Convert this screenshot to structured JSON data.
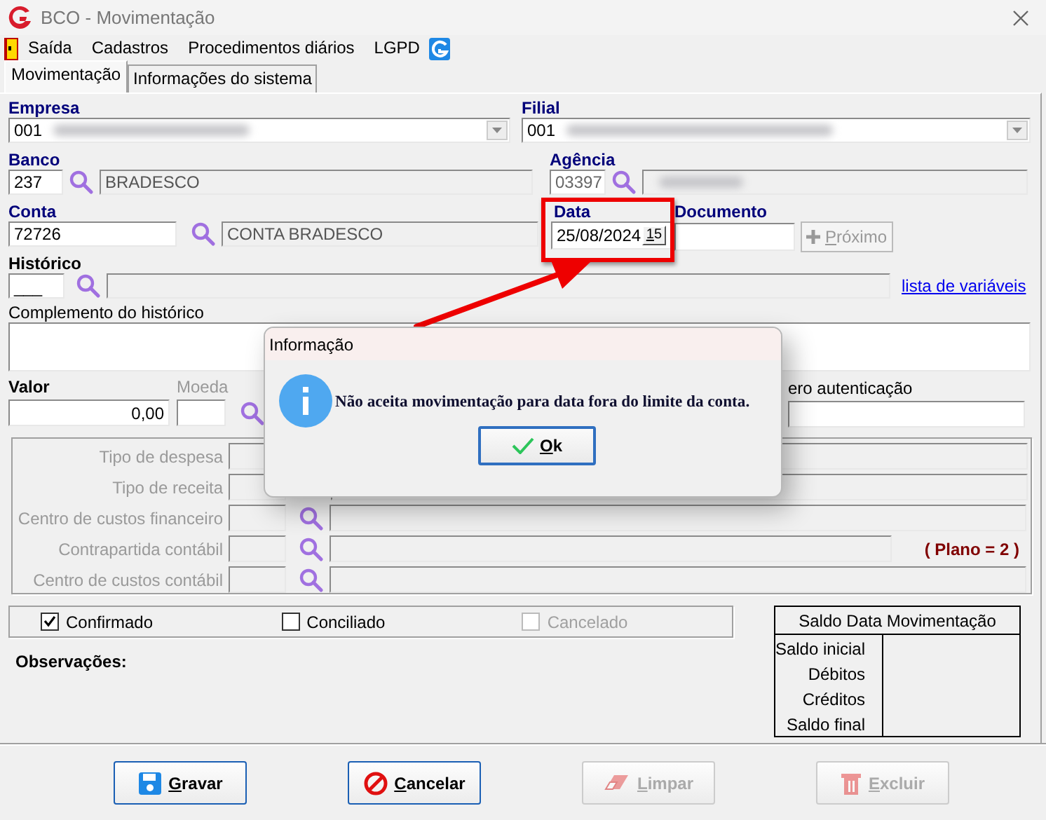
{
  "window": {
    "title": "BCO - Movimentação"
  },
  "menu": [
    {
      "label": "Saída"
    },
    {
      "label": "Cadastros"
    },
    {
      "label": "Procedimentos diários"
    },
    {
      "label": "LGPD"
    }
  ],
  "tabs": [
    {
      "label": "Movimentação",
      "selected": true
    },
    {
      "label": "Informações do sistema",
      "selected": false
    }
  ],
  "empresa": {
    "label": "Empresa",
    "value": "001"
  },
  "filial": {
    "label": "Filial",
    "value": "001"
  },
  "banco": {
    "label": "Banco",
    "code": "237",
    "name": "BRADESCO"
  },
  "agencia": {
    "label": "Agência",
    "code": "03397"
  },
  "conta": {
    "label": "Conta",
    "code": "72726",
    "name": "CONTA BRADESCO"
  },
  "data": {
    "label": "Data",
    "value": "25/08/2024",
    "calendar_button": "15"
  },
  "documento": {
    "label": "Documento"
  },
  "next_button": {
    "label": "Próximo",
    "disabled": true
  },
  "historico": {
    "label": "Histórico",
    "code": "___"
  },
  "variables_link": "lista de variáveis",
  "complemento": {
    "label": "Complemento do histórico"
  },
  "valor": {
    "label": "Valor",
    "value": "0,00"
  },
  "moeda": {
    "label": "Moeda"
  },
  "autenticacao": {
    "label": "ero autenticação"
  },
  "classification_rows": [
    {
      "label": "Tipo de despesa",
      "search": false
    },
    {
      "label": "Tipo de receita",
      "search": false
    },
    {
      "label": "Centro de custos financeiro",
      "search": true
    },
    {
      "label": "Contrapartida contábil",
      "search": true,
      "note": "( Plano = 2 )"
    },
    {
      "label": "Centro de custos contábil",
      "search": true
    }
  ],
  "flags": [
    {
      "label": "Confirmado",
      "checked": true,
      "disabled": false
    },
    {
      "label": "Conciliado",
      "checked": false,
      "disabled": false
    },
    {
      "label": "Cancelado",
      "checked": false,
      "disabled": true
    }
  ],
  "observacoes": "Observações:",
  "saldo": {
    "title": "Saldo Data Movimentação",
    "rows": [
      "Saldo inicial",
      "Débitos",
      "Créditos",
      "Saldo final"
    ]
  },
  "buttons": [
    {
      "label": "Gravar",
      "kind": "save",
      "disabled": false
    },
    {
      "label": "Cancelar",
      "kind": "cancel",
      "disabled": false
    },
    {
      "label": "Limpar",
      "kind": "clear",
      "disabled": true
    },
    {
      "label": "Excluir",
      "kind": "delete",
      "disabled": true
    }
  ],
  "dialog": {
    "title": "Informação",
    "message": "Não aceita movimentação para data fora do limite da conta.",
    "ok": "Ok"
  }
}
